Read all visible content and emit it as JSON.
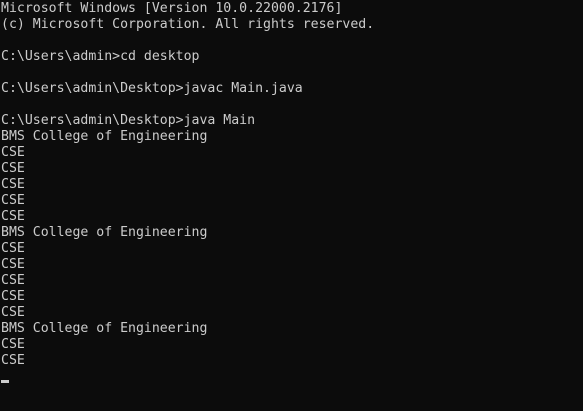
{
  "window": {
    "background": "#0c0c0c",
    "foreground": "#cccccc"
  },
  "terminal": {
    "lines": [
      "Microsoft Windows [Version 10.0.22000.2176]",
      "(c) Microsoft Corporation. All rights reserved.",
      "",
      "C:\\Users\\admin>cd desktop",
      "",
      "C:\\Users\\admin\\Desktop>javac Main.java",
      "",
      "C:\\Users\\admin\\Desktop>java Main",
      "BMS College of Engineering",
      "CSE",
      "CSE",
      "CSE",
      "CSE",
      "CSE",
      "BMS College of Engineering",
      "CSE",
      "CSE",
      "CSE",
      "CSE",
      "CSE",
      "BMS College of Engineering",
      "CSE",
      "CSE"
    ]
  }
}
